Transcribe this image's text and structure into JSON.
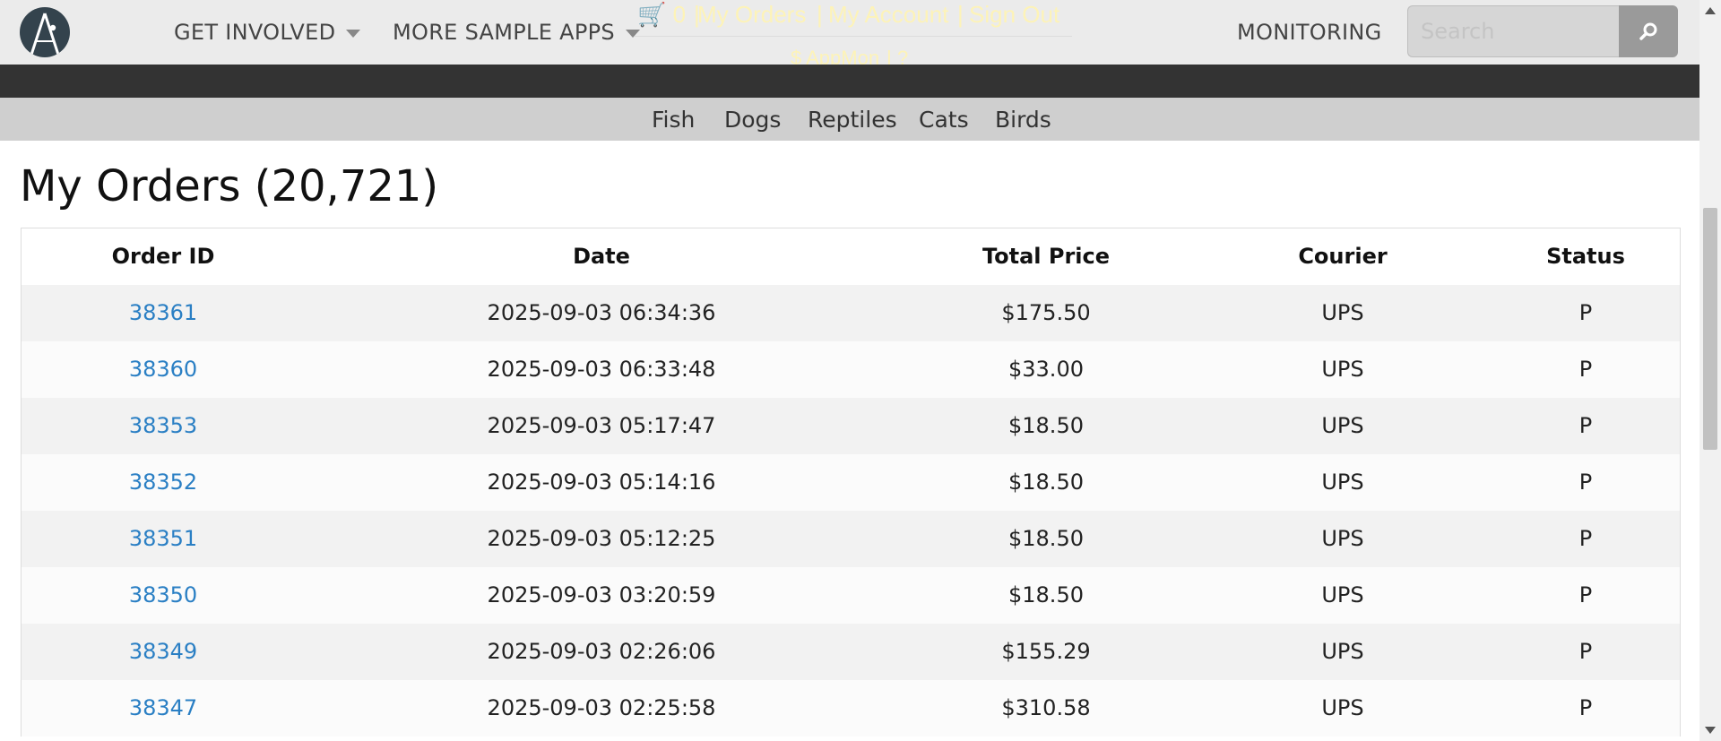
{
  "header": {
    "nav": [
      {
        "label": "GET INVOLVED"
      },
      {
        "label": "MORE SAMPLE APPS"
      }
    ],
    "overlay": {
      "cart_count": "🛒 0",
      "sep": "|",
      "my_orders": "My Orders",
      "my_account": "My Account",
      "sign_out": "Sign Out",
      "appmon": "$ AppMon",
      "help": "?"
    },
    "monitoring": "MONITORING",
    "search": {
      "placeholder": "Search",
      "value": ""
    }
  },
  "categories": [
    "Fish",
    "Dogs",
    "Reptiles",
    "Cats",
    "Birds"
  ],
  "page_title": "My Orders (20,721)",
  "orders_table": {
    "columns": [
      "Order ID",
      "Date",
      "Total Price",
      "Courier",
      "Status"
    ],
    "rows": [
      {
        "id": "38361",
        "date": "2025-09-03 06:34:36",
        "total": "$175.50",
        "courier": "UPS",
        "status": "P"
      },
      {
        "id": "38360",
        "date": "2025-09-03 06:33:48",
        "total": "$33.00",
        "courier": "UPS",
        "status": "P"
      },
      {
        "id": "38353",
        "date": "2025-09-03 05:17:47",
        "total": "$18.50",
        "courier": "UPS",
        "status": "P"
      },
      {
        "id": "38352",
        "date": "2025-09-03 05:14:16",
        "total": "$18.50",
        "courier": "UPS",
        "status": "P"
      },
      {
        "id": "38351",
        "date": "2025-09-03 05:12:25",
        "total": "$18.50",
        "courier": "UPS",
        "status": "P"
      },
      {
        "id": "38350",
        "date": "2025-09-03 03:20:59",
        "total": "$18.50",
        "courier": "UPS",
        "status": "P"
      },
      {
        "id": "38349",
        "date": "2025-09-03 02:26:06",
        "total": "$155.29",
        "courier": "UPS",
        "status": "P"
      },
      {
        "id": "38347",
        "date": "2025-09-03 02:25:58",
        "total": "$310.58",
        "courier": "UPS",
        "status": "P"
      }
    ]
  },
  "colors": {
    "topbar_bg": "#ebebeb",
    "dark_band": "#333333",
    "category_bar": "#cfcfcf",
    "link": "#2a7fc4",
    "row_alt": "#f2f2f2"
  },
  "icons": {
    "logo": "a-logo-icon",
    "search": "search-icon",
    "caret": "caret-down-icon"
  }
}
